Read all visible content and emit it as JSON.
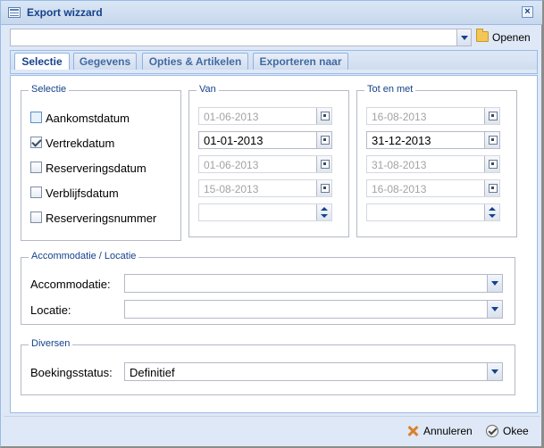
{
  "window": {
    "title": "Export wizzard",
    "close_icon": "close-icon"
  },
  "toolbar": {
    "file_value": "",
    "open_label": "Openen",
    "open_icon": "folder-open-icon"
  },
  "tabs": [
    {
      "label": "Selectie",
      "active": true
    },
    {
      "label": "Gegevens",
      "active": false
    },
    {
      "label": "Opties & Artikelen",
      "active": false
    },
    {
      "label": "Exporteren naar",
      "active": false
    }
  ],
  "selectie": {
    "legend": "Selectie",
    "items": [
      {
        "label": "Aankomstdatum",
        "checked": false
      },
      {
        "label": "Vertrekdatum",
        "checked": true
      },
      {
        "label": "Reserveringsdatum",
        "checked": false
      },
      {
        "label": "Verblijfsdatum",
        "checked": false
      },
      {
        "label": "Reserveringsnummer",
        "checked": false
      }
    ]
  },
  "van": {
    "legend": "Van",
    "values": [
      "01-06-2013",
      "01-01-2013",
      "01-06-2013",
      "15-08-2013",
      ""
    ]
  },
  "tot": {
    "legend": "Tot en met",
    "values": [
      "16-08-2013",
      "31-12-2013",
      "31-08-2013",
      "16-08-2013",
      ""
    ]
  },
  "accommodatie": {
    "legend": "Accommodatie / Locatie",
    "accommodatie_label": "Accommodatie:",
    "accommodatie_value": "",
    "locatie_label": "Locatie:",
    "locatie_value": ""
  },
  "diversen": {
    "legend": "Diversen",
    "boekingsstatus_label": "Boekingsstatus:",
    "boekingsstatus_value": "Definitief"
  },
  "footer": {
    "cancel_label": "Annuleren",
    "ok_label": "Okee"
  },
  "colors": {
    "accent": "#15428b",
    "frame": "#99bbe8",
    "background": "#dfe8f6"
  }
}
